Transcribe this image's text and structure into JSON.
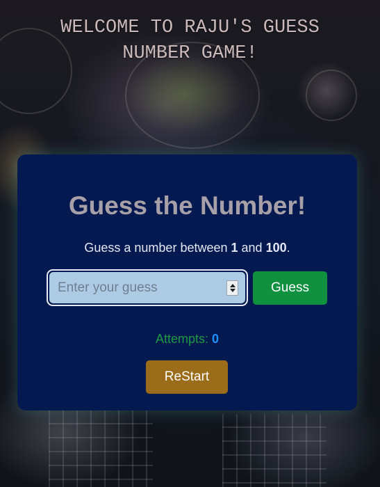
{
  "header": {
    "title_line1": "WELCOME TO RAJU'S GUESS",
    "title_line2": "NUMBER GAME!"
  },
  "game": {
    "heading": "Guess the Number!",
    "instructions": {
      "prefix": "Guess a number between ",
      "min": "1",
      "middle": " and ",
      "max": "100",
      "suffix": "."
    },
    "input": {
      "placeholder": "Enter your guess",
      "value": ""
    },
    "guess_button_label": "Guess",
    "attempts": {
      "label": "Attempts: ",
      "count": "0"
    },
    "restart_button_label": "ReStart"
  },
  "colors": {
    "card_background": "#04194f",
    "guess_button": "#109140",
    "restart_button": "#9b6c1a",
    "attempts_label": "#1c9a45",
    "attempts_count": "#1e90ff",
    "input_background": "#aecbe6"
  }
}
